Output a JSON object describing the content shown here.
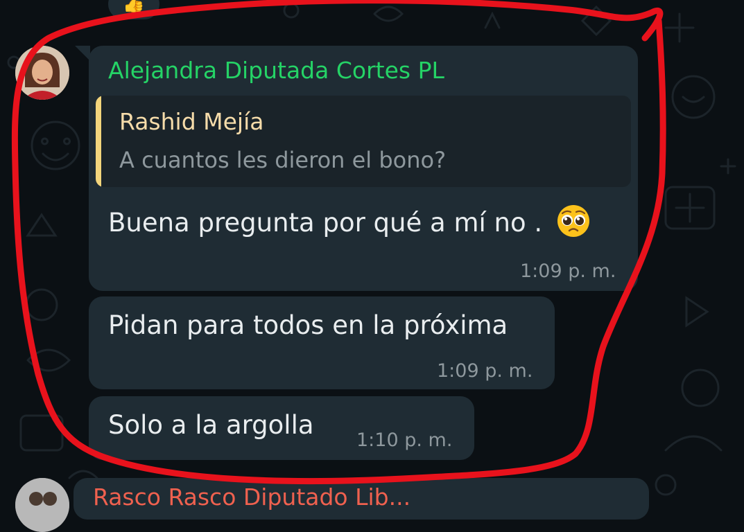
{
  "reaction": {
    "emoji": "👍"
  },
  "message_group": {
    "sender": "Alejandra Diputada Cortes PL",
    "sender_color": "#25d366",
    "quoted": {
      "author": "Rashid Mejía",
      "text": "A cuantos les dieron el bono?",
      "accent_color": "#f3d57c"
    },
    "messages": [
      {
        "text": "Buena pregunta por qué a mí no .",
        "emoji": "🥺",
        "time": "1:09 p. m."
      },
      {
        "text": "Pidan para todos en la próxima",
        "time": "1:09 p. m."
      },
      {
        "text": "Solo a la argolla",
        "time": "1:10 p. m."
      }
    ]
  },
  "next_message": {
    "sender": "Rasco Rasco Diputado Lib..."
  },
  "colors": {
    "background": "#0b1014",
    "bubble": "#1f2c34",
    "annotation": "#e8121c"
  }
}
